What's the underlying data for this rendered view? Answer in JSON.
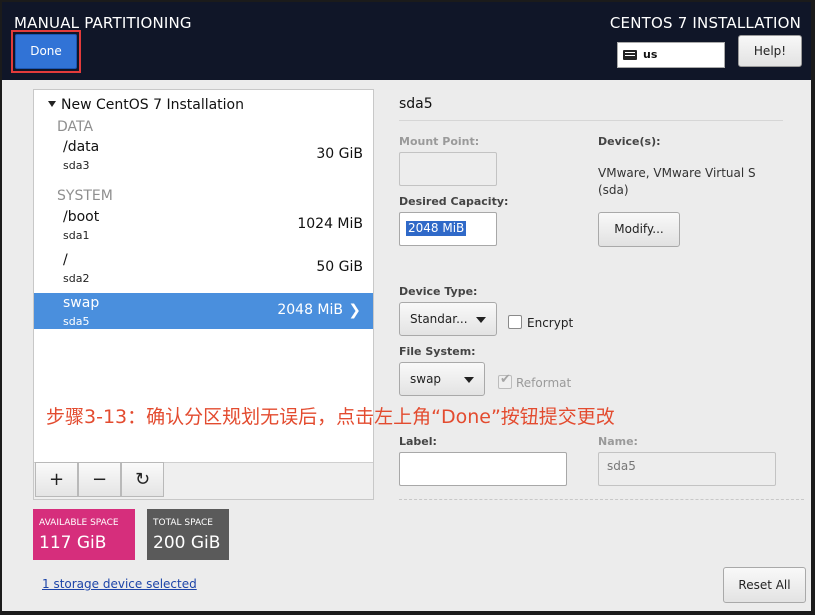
{
  "header": {
    "title": "MANUAL PARTITIONING",
    "installer_title": "CENTOS 7 INSTALLATION",
    "done_label": "Done",
    "keyboard_layout": "us",
    "help_label": "Help!",
    "keyboard_icon": "keyboard-icon"
  },
  "tree": {
    "root_label": "New CentOS 7 Installation",
    "groups": [
      {
        "label": "DATA",
        "partitions": [
          {
            "mount": "/data",
            "device": "sda3",
            "size": "30 GiB"
          }
        ]
      },
      {
        "label": "SYSTEM",
        "partitions": [
          {
            "mount": "/boot",
            "device": "sda1",
            "size": "1024 MiB"
          },
          {
            "mount": "/",
            "device": "sda2",
            "size": "50 GiB"
          },
          {
            "mount": "swap",
            "device": "sda5",
            "size": "2048 MiB",
            "selected": true
          }
        ]
      }
    ],
    "selected_chevron": "❯",
    "toolbar": {
      "add": "+",
      "remove": "−",
      "refresh": "↻"
    }
  },
  "space": {
    "available_label": "AVAILABLE SPACE",
    "available_value": "117 GiB",
    "total_label": "TOTAL SPACE",
    "total_value": "200 GiB",
    "available_color": "#d62e7c",
    "total_color": "#5a5a5a"
  },
  "storage_link": "1 storage device selected",
  "detail": {
    "title": "sda5",
    "mount_point_label": "Mount Point:",
    "mount_point_value": "",
    "desired_capacity_label": "Desired Capacity:",
    "desired_capacity_value": "2048 MiB",
    "devices_label": "Device(s):",
    "device_line1": "VMware, VMware Virtual S",
    "device_line2": "(sda)",
    "modify_label": "Modify...",
    "device_type_label": "Device Type:",
    "device_type_value": "Standar...",
    "encrypt_label": "Encrypt",
    "encrypt_checked": false,
    "file_system_label": "File System:",
    "file_system_value": "swap",
    "reformat_label": "Reformat",
    "reformat_checked": true,
    "label_label": "Label:",
    "label_value": "",
    "name_label": "Name:",
    "name_value": "sda5"
  },
  "annotation": "步骤3-13：确认分区规划无误后，点击左上角“Done”按钮提交更改",
  "reset_label": "Reset All",
  "colors": {
    "header_bg": "#101628",
    "done_button": "#3173d6",
    "highlight_border": "#e23b3b",
    "selected_row": "#4a8fdd",
    "annotation": "#e34b2f"
  }
}
